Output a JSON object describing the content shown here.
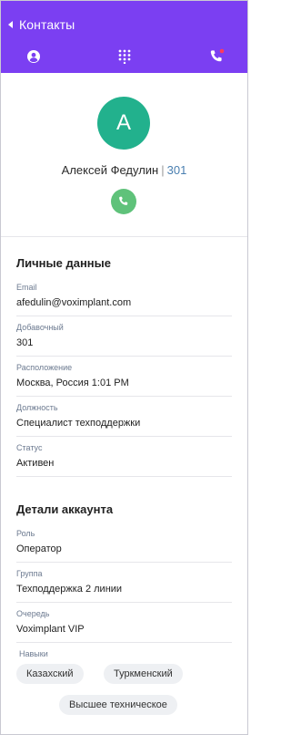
{
  "header": {
    "back_label": "Контакты",
    "background_color": "#7b3ff2",
    "tabs": [
      {
        "name": "profile-tab",
        "icon": "user-circle-icon"
      },
      {
        "name": "dialpad-tab",
        "icon": "dialpad-icon"
      },
      {
        "name": "calls-tab",
        "icon": "phone-missed-icon",
        "badge_color": "#ff3b5c"
      }
    ]
  },
  "profile": {
    "avatar_initial": "А",
    "avatar_color": "#22b18d",
    "name": "Алексей Федулин",
    "separator": "|",
    "extension": "301",
    "call_button_color": "#5fc27a"
  },
  "personal": {
    "title": "Личные данные",
    "fields": [
      {
        "label": "Email",
        "value": "afedulin@voximplant.com"
      },
      {
        "label": "Добавочный",
        "value": "301"
      },
      {
        "label": "Расположение",
        "value": "Москва, Россия 1:01 PM"
      },
      {
        "label": "Должность",
        "value": "Специалист техподдержки"
      },
      {
        "label": "Статус",
        "value": "Активен"
      }
    ]
  },
  "account": {
    "title": "Детали аккаунта",
    "fields": [
      {
        "label": "Роль",
        "value": "Оператор"
      },
      {
        "label": "Группа",
        "value": "Техподдержка 2 линии"
      },
      {
        "label": "Очередь",
        "value": "Voximplant VIP"
      }
    ],
    "skills_label": "Навыки",
    "skills": [
      "Казахский",
      "Туркменский",
      "Высшее техническое"
    ]
  }
}
